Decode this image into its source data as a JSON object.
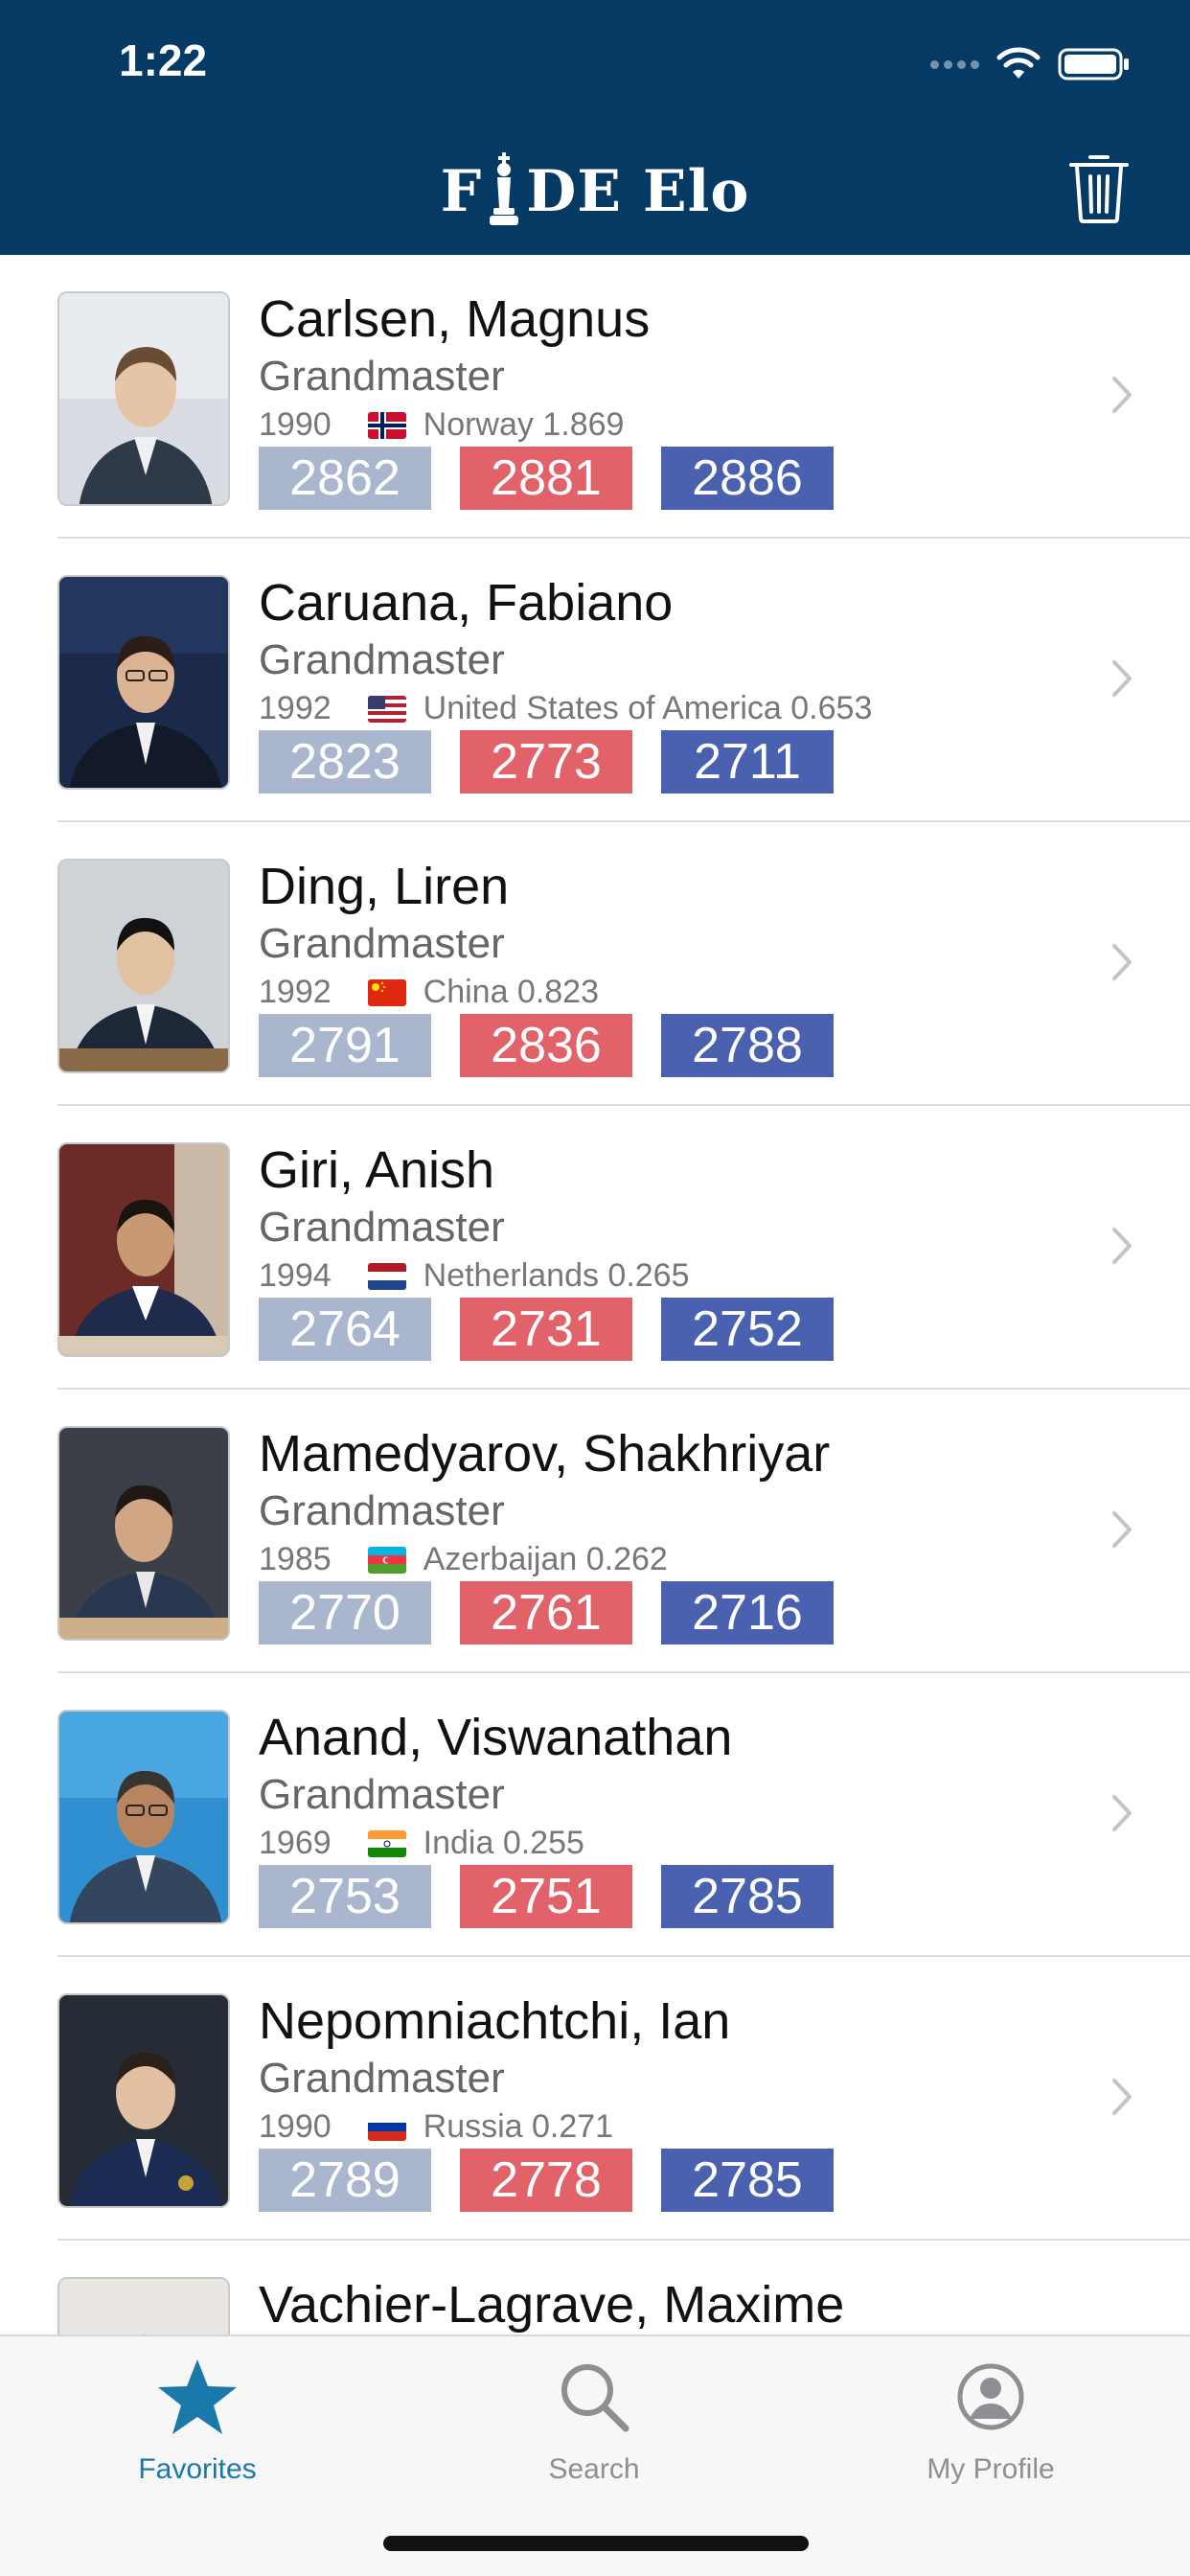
{
  "status_bar": {
    "time": "1:22"
  },
  "header": {
    "title_before": "F",
    "title_after": "DE Elo"
  },
  "players": [
    {
      "name": "Carlsen, Magnus",
      "title": "Grandmaster",
      "year": "1990",
      "country": "Norway 1.869",
      "flag": "norway",
      "ratings": [
        "2862",
        "2881",
        "2886"
      ]
    },
    {
      "name": "Caruana, Fabiano",
      "title": "Grandmaster",
      "year": "1992",
      "country": "United States of America 0.653",
      "flag": "usa",
      "ratings": [
        "2823",
        "2773",
        "2711"
      ]
    },
    {
      "name": "Ding, Liren",
      "title": "Grandmaster",
      "year": "1992",
      "country": "China 0.823",
      "flag": "china",
      "ratings": [
        "2791",
        "2836",
        "2788"
      ]
    },
    {
      "name": "Giri, Anish",
      "title": "Grandmaster",
      "year": "1994",
      "country": "Netherlands 0.265",
      "flag": "netherlands",
      "ratings": [
        "2764",
        "2731",
        "2752"
      ]
    },
    {
      "name": "Mamedyarov, Shakhriyar",
      "title": "Grandmaster",
      "year": "1985",
      "country": "Azerbaijan 0.262",
      "flag": "azerbaijan",
      "ratings": [
        "2770",
        "2761",
        "2716"
      ]
    },
    {
      "name": "Anand, Viswanathan",
      "title": "Grandmaster",
      "year": "1969",
      "country": "India 0.255",
      "flag": "india",
      "ratings": [
        "2753",
        "2751",
        "2785"
      ]
    },
    {
      "name": "Nepomniachtchi, Ian",
      "title": "Grandmaster",
      "year": "1990",
      "country": "Russia 0.271",
      "flag": "russia",
      "ratings": [
        "2789",
        "2778",
        "2785"
      ]
    },
    {
      "name": "Vachier-Lagrave, Maxime"
    }
  ],
  "colors": {
    "header_bg": "#043a63",
    "standard": "#a9b6cd",
    "rapid": "#e2626a",
    "blitz": "#4a61b0",
    "tab_active": "#1a79a8",
    "tab_inactive": "#8e8e93"
  },
  "tabs": [
    {
      "label": "Favorites",
      "icon": "star-icon",
      "active": true
    },
    {
      "label": "Search",
      "icon": "search-icon",
      "active": false
    },
    {
      "label": "My Profile",
      "icon": "profile-icon",
      "active": false
    }
  ]
}
